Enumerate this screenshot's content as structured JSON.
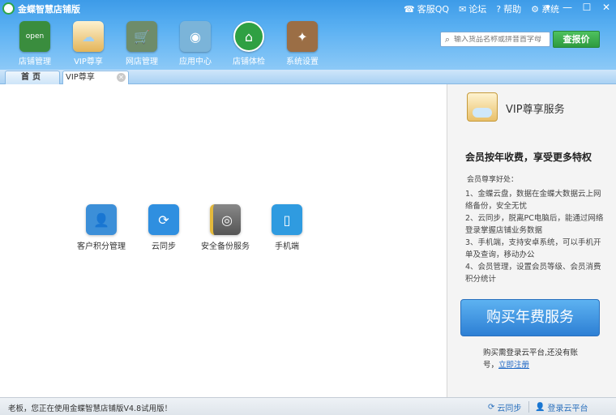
{
  "app": {
    "title": "金蝶智慧店铺版"
  },
  "title_links": [
    {
      "icon": "headset-icon",
      "glyph": "☎",
      "label": "客服QQ"
    },
    {
      "icon": "forum-icon",
      "glyph": "✉",
      "label": "论坛"
    },
    {
      "icon": "help-icon",
      "glyph": "?",
      "label": "帮助"
    },
    {
      "icon": "gear-icon",
      "glyph": "⚙",
      "label": "系统"
    }
  ],
  "window_controls": {
    "restore": "▾",
    "minimize": "—",
    "maximize": "☐",
    "close": "✕"
  },
  "toolbar": [
    {
      "key": "store-management",
      "icon": "store-icon",
      "label": "店铺管理",
      "color": "#3a8d3e",
      "glyph": "open"
    },
    {
      "key": "vip",
      "icon": "vip-icon",
      "label": "VIP尊享",
      "color": "#e4b559",
      "glyph": "☁"
    },
    {
      "key": "online-store",
      "icon": "shopping-cart-icon",
      "label": "网店管理",
      "color": "#6e8c6a",
      "glyph": "🛒"
    },
    {
      "key": "app-center",
      "icon": "app-center-icon",
      "label": "应用中心",
      "color": "#7bb4d9",
      "glyph": "◉"
    },
    {
      "key": "store-check",
      "icon": "home-check-icon",
      "label": "店铺体检",
      "color": "#2fa043",
      "glyph": "⌂"
    },
    {
      "key": "settings",
      "icon": "toolbox-icon",
      "label": "系统设置",
      "color": "#9b6e45",
      "glyph": "✦"
    }
  ],
  "search": {
    "placeholder": "输入货品名称或拼音首字母",
    "button_label": "查报价"
  },
  "tabs": [
    {
      "label": "首页"
    },
    {
      "label": "VIP尊享",
      "close": "✕"
    }
  ],
  "features": [
    {
      "key": "customer-points",
      "icon": "customer-points-icon",
      "label": "客户积分管理",
      "color": "#3c8fd8",
      "glyph": "👤"
    },
    {
      "key": "cloud-sync",
      "icon": "cloud-sync-icon",
      "label": "云同步",
      "color": "#2f8fe0",
      "glyph": "⟳"
    },
    {
      "key": "secure-backup",
      "icon": "safe-icon",
      "label": "安全备份服务",
      "color": "#6b6b6b",
      "glyph": "◎"
    },
    {
      "key": "mobile",
      "icon": "mobile-icon",
      "label": "手机端",
      "color": "#2f9be0",
      "glyph": "▯"
    }
  ],
  "vip_panel": {
    "title": "VIP尊享服务",
    "slogan": "会员按年收费，享受更多特权",
    "benefits_title": "会员尊享好处：",
    "benefits": [
      "1、金蝶云盘，数据在金蝶大数据云上网络备份，安全无忧",
      "2、云同步，脱离PC电脑后，能通过网络登录掌握店铺业务数据",
      "3、手机端，支持安卓系统，可以手机开单及查询，移动办公",
      "4、会员管理，设置会员等级、会员消费积分统计"
    ],
    "buy_button": "购买年费服务",
    "login_note_prefix": "购买需登录云平台,还没有账号，",
    "login_note_link": "立即注册"
  },
  "statusbar": {
    "text": "老板，您正在使用金蝶智慧店铺版V4.8试用版！",
    "sync_label": "云同步",
    "login_label": "登录云平台"
  }
}
